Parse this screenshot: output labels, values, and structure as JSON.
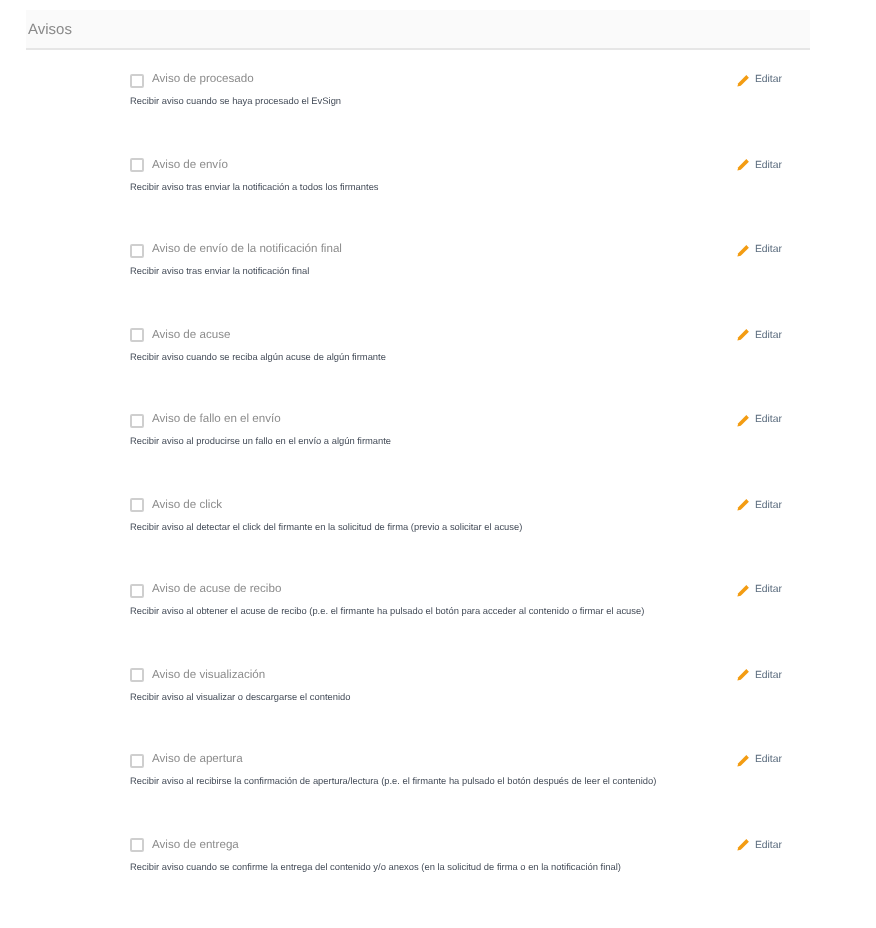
{
  "section": {
    "title": "Avisos"
  },
  "notifications": [
    {
      "label": "Aviso de procesado",
      "checked": false,
      "description": "Recibir aviso cuando se haya procesado el EvSign",
      "action": "Editar"
    },
    {
      "label": "Aviso de envío",
      "checked": false,
      "description": "Recibir aviso tras enviar la notificación a todos los firmantes",
      "action": "Editar"
    },
    {
      "label": "Aviso de envío de la notificación final",
      "checked": false,
      "description": "Recibir aviso tras enviar la notificación final",
      "action": "Editar"
    },
    {
      "label": "Aviso de acuse",
      "checked": false,
      "description": "Recibir aviso cuando se reciba algún acuse de algún firmante",
      "action": "Editar"
    },
    {
      "label": "Aviso de fallo en el envío",
      "checked": false,
      "description": "Recibir aviso al producirse un fallo en el envío a algún firmante",
      "action": "Editar"
    },
    {
      "label": "Aviso de click",
      "checked": false,
      "description": "Recibir aviso al detectar el click del firmante en la solicitud de firma (previo a solicitar el acuse)",
      "action": "Editar"
    },
    {
      "label": "Aviso de acuse de recibo",
      "checked": false,
      "description": "Recibir aviso al obtener el acuse de recibo (p.e. el firmante ha pulsado el botón para acceder al contenido o firmar el acuse)",
      "action": "Editar"
    },
    {
      "label": "Aviso de visualización",
      "checked": false,
      "description": "Recibir aviso al visualizar o descargarse el contenido",
      "action": "Editar"
    },
    {
      "label": "Aviso de apertura",
      "checked": false,
      "description": "Recibir aviso al recibirse la confirmación de apertura/lectura (p.e. el firmante ha pulsado el botón después de leer el contenido)",
      "action": "Editar"
    },
    {
      "label": "Aviso de entrega",
      "checked": false,
      "description": "Recibir aviso cuando se confirme la entrega del contenido y/o anexos (en la solicitud de firma o en la notificación final)",
      "action": "Editar"
    }
  ]
}
